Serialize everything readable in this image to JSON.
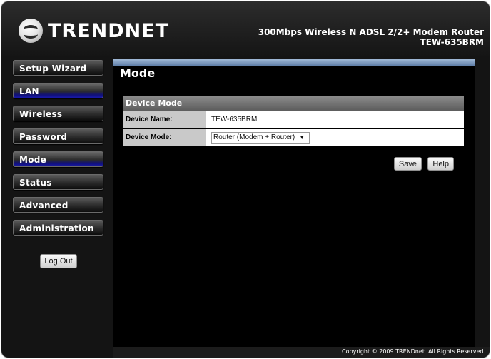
{
  "brand": {
    "logo_text": "TRENDNET",
    "product_line1": "300Mbps Wireless N ADSL 2/2+ Modem Router",
    "product_line2": "TEW-635BRM"
  },
  "sidebar": {
    "items": [
      {
        "label": "Setup Wizard",
        "active": false
      },
      {
        "label": "LAN",
        "active": true
      },
      {
        "label": "Wireless",
        "active": false
      },
      {
        "label": "Password",
        "active": false
      },
      {
        "label": "Mode",
        "active": true
      },
      {
        "label": "Status",
        "active": false
      },
      {
        "label": "Advanced",
        "active": false
      },
      {
        "label": "Administration",
        "active": false
      }
    ],
    "logout_label": "Log Out"
  },
  "main": {
    "title": "Mode",
    "panel_title": "Device Mode",
    "fields": {
      "device_name": {
        "label": "Device Name:",
        "value": "TEW-635BRM"
      },
      "device_mode": {
        "label": "Device Mode:",
        "value": "Router (Modem + Router)"
      }
    },
    "save_label": "Save",
    "help_label": "Help"
  },
  "footer": {
    "copyright": "Copyright © 2009 TRENDnet. All Rights Reserved."
  },
  "colors": {
    "accent_blue": "#1919a8",
    "panel_header": "#6e6e6e",
    "background": "#000000"
  }
}
